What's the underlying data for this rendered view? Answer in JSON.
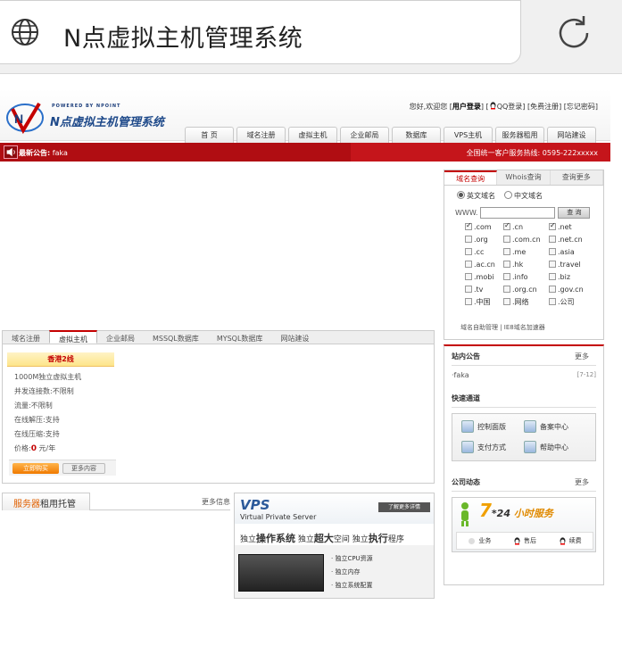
{
  "browser": {
    "title": "N点虚拟主机管理系统"
  },
  "site": {
    "logo_top": "POWERED BY NPOINT",
    "logo_name": "N点虚拟主机管理系统",
    "toplinks": {
      "greeting": "您好,欢迎您 [",
      "user_login": "用户登录",
      "mid1": "] [",
      "qq_login": "QQ登录",
      "mid2": "] [",
      "free_register": "免费注册",
      "mid3": "] [",
      "forgot_pwd": "忘记密码",
      "end": "]"
    },
    "nav": [
      "首 页",
      "域名注册",
      "虚拟主机",
      "企业邮局",
      "数据库",
      "VPS主机",
      "服务器租用",
      "网站建设"
    ],
    "notice_label": "最新公告:",
    "notice_text": "faka",
    "hotline": "全国统一客户服务热线: 0595-222xxxxx"
  },
  "product_tabs": [
    "域名注册",
    "虚拟主机",
    "企业邮局",
    "MSSQL数据库",
    "MYSQL数据库",
    "网站建设"
  ],
  "host_card": {
    "title": "香港2线",
    "specs": [
      "1000M独立虚拟主机",
      "并发连接数:不限制",
      "流量:不限制",
      "在线解压:支持",
      "在线压缩:支持"
    ],
    "price_label": "价格:",
    "price_value": "0",
    "price_unit": "元/年",
    "buy_label": "立即购买",
    "more_label": "更多内容"
  },
  "server": {
    "tab_orange": "服务器",
    "tab_rest": "租用托管",
    "more": "更多信息"
  },
  "vps_banner": {
    "logo": "VPS",
    "sub": "Virtual Private Server",
    "btn": "了解更多详情",
    "slogan_parts": [
      "独立",
      "操作系统",
      "独立",
      "超大",
      "空间",
      "独立",
      "执行",
      "程序"
    ],
    "features": [
      "独立CPU资源",
      "独立内存",
      "独立系统配置"
    ]
  },
  "domain_box": {
    "tabs": [
      "域名查询",
      "Whois查询",
      "查询更多"
    ],
    "radio_en": "英文域名",
    "radio_cn": "中文域名",
    "www": "WWW.",
    "search_btn": "查 询",
    "tlds": [
      {
        "n": ".com",
        "c": true
      },
      {
        "n": ".cn",
        "c": true
      },
      {
        "n": ".net",
        "c": true
      },
      {
        "n": ".org",
        "c": false
      },
      {
        "n": ".com.cn",
        "c": false
      },
      {
        "n": ".net.cn",
        "c": false
      },
      {
        "n": ".cc",
        "c": false
      },
      {
        "n": ".me",
        "c": false
      },
      {
        "n": ".asia",
        "c": false
      },
      {
        "n": ".ac.cn",
        "c": false
      },
      {
        "n": ".hk",
        "c": false
      },
      {
        "n": ".travel",
        "c": false
      },
      {
        "n": ".mobi",
        "c": false
      },
      {
        "n": ".info",
        "c": false
      },
      {
        "n": ".biz",
        "c": false
      },
      {
        "n": ".tv",
        "c": false
      },
      {
        "n": ".org.cn",
        "c": false
      },
      {
        "n": ".gov.cn",
        "c": false
      },
      {
        "n": ".中国",
        "c": false
      },
      {
        "n": ".网络",
        "c": false
      },
      {
        "n": ".公司",
        "c": false
      }
    ],
    "links": "域名自助管理 | IE8域名加速器"
  },
  "announce": {
    "title": "站内公告",
    "more": "更多",
    "item": "·faka",
    "date": "[7-12]"
  },
  "quick": {
    "title": "快速通道",
    "items": [
      "控制面版",
      "备案中心",
      "支付方式",
      "帮助中心"
    ]
  },
  "news": {
    "title": "公司动态",
    "more": "更多"
  },
  "service": {
    "seven": "7",
    "star": "*24",
    "rest": " 小时服务",
    "btns": [
      "业务",
      "售后",
      "续费"
    ]
  }
}
